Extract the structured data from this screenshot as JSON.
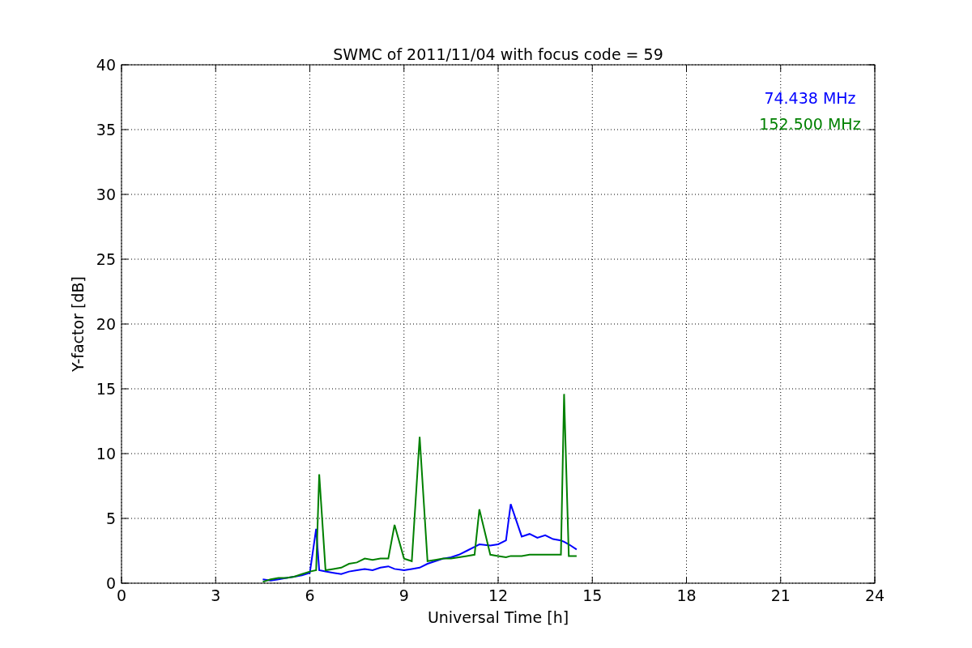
{
  "chart_data": {
    "type": "line",
    "title": "SWMC of 2011/11/04 with focus code = 59",
    "xlabel": "Universal Time [h]",
    "ylabel": "Y-factor [dB]",
    "x": [
      4.5,
      4.75,
      5,
      5.25,
      5.5,
      5.75,
      6,
      6.2,
      6.3,
      6.5,
      6.75,
      7,
      7.25,
      7.5,
      7.75,
      8,
      8.25,
      8.5,
      8.7,
      9,
      9.25,
      9.5,
      9.75,
      10,
      10.25,
      10.5,
      10.75,
      11,
      11.25,
      11.4,
      11.75,
      12,
      12.25,
      12.4,
      12.75,
      13,
      13.25,
      13.5,
      13.75,
      14,
      14.1,
      14.25,
      14.5
    ],
    "series": [
      {
        "name": "74.438 MHz",
        "color": "#0000ff",
        "values": [
          0.3,
          0.2,
          0.3,
          0.4,
          0.5,
          0.6,
          0.8,
          4.2,
          1.0,
          0.9,
          0.8,
          0.7,
          0.9,
          1.0,
          1.1,
          1.0,
          1.2,
          1.3,
          1.1,
          1.0,
          1.1,
          1.2,
          1.5,
          1.7,
          1.9,
          2.0,
          2.2,
          2.5,
          2.8,
          3.0,
          2.9,
          3.0,
          3.3,
          6.1,
          3.6,
          3.8,
          3.5,
          3.7,
          3.4,
          3.3,
          3.2,
          3.0,
          2.6
        ]
      },
      {
        "name": "152.500 MHz",
        "color": "#008000",
        "values": [
          0.1,
          0.3,
          0.4,
          0.4,
          0.5,
          0.7,
          0.9,
          1.0,
          8.4,
          1.0,
          1.1,
          1.2,
          1.5,
          1.6,
          1.9,
          1.8,
          1.9,
          1.9,
          4.5,
          1.9,
          1.7,
          11.3,
          1.7,
          1.8,
          1.9,
          1.9,
          2.0,
          2.1,
          2.2,
          5.7,
          2.2,
          2.1,
          2.0,
          2.1,
          2.1,
          2.2,
          2.2,
          2.2,
          2.2,
          2.2,
          14.6,
          2.1,
          2.1
        ]
      }
    ],
    "xlim": [
      0,
      24
    ],
    "ylim": [
      0,
      40
    ],
    "xticks": [
      0,
      3,
      6,
      9,
      12,
      15,
      18,
      21,
      24
    ],
    "yticks": [
      0,
      5,
      10,
      15,
      20,
      25,
      30,
      35,
      40
    ],
    "grid": true
  }
}
